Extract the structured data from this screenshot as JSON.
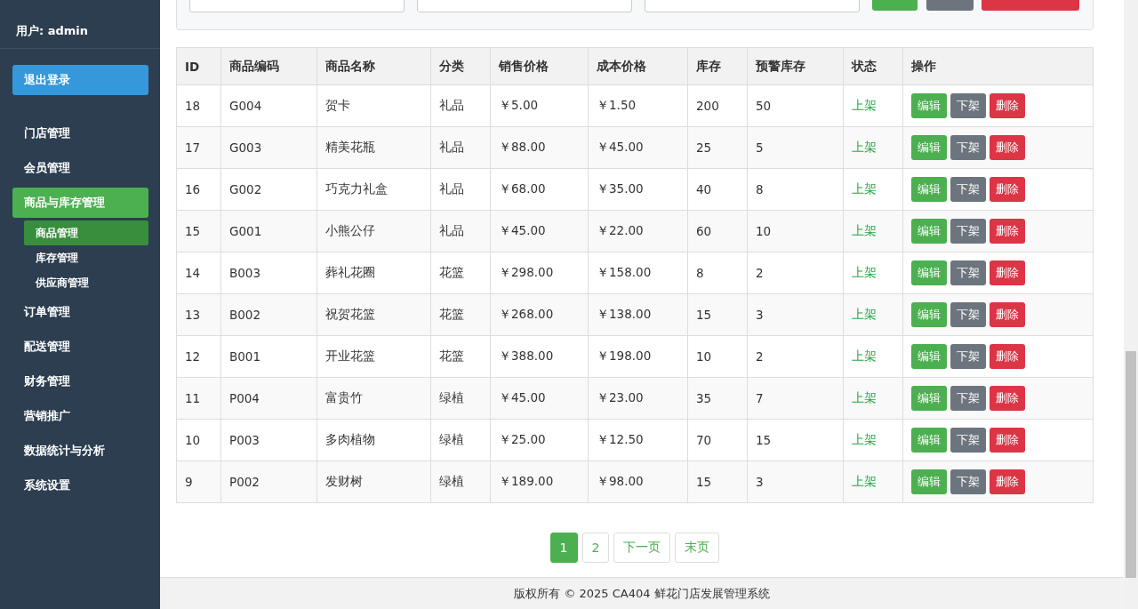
{
  "sidebar": {
    "user": "用户: admin",
    "logout": "退出登录",
    "items": [
      {
        "label": "门店管理",
        "selected": false
      },
      {
        "label": "会员管理",
        "selected": false
      },
      {
        "label": "商品与库存管理",
        "selected": true,
        "children": [
          {
            "label": "商品管理",
            "selected": true
          },
          {
            "label": "库存管理",
            "selected": false
          },
          {
            "label": "供应商管理",
            "selected": false
          }
        ]
      },
      {
        "label": "订单管理",
        "selected": false
      },
      {
        "label": "配送管理",
        "selected": false
      },
      {
        "label": "财务管理",
        "selected": false
      },
      {
        "label": "营销推广",
        "selected": false
      },
      {
        "label": "数据统计与分析",
        "selected": false
      },
      {
        "label": "系统设置",
        "selected": false
      }
    ]
  },
  "table": {
    "columns": [
      "ID",
      "商品编码",
      "商品名称",
      "分类",
      "销售价格",
      "成本价格",
      "库存",
      "预警库存",
      "状态",
      "操作"
    ],
    "rows": [
      {
        "cells": [
          "18",
          "G004",
          "贺卡",
          "礼品",
          "￥5.00",
          "￥1.50",
          "200",
          "50"
        ],
        "status": "上架",
        "actions": [
          {
            "label": "编辑",
            "kind": "edit"
          },
          {
            "label": "下架",
            "kind": "toggle"
          },
          {
            "label": "删除",
            "kind": "delete"
          }
        ]
      },
      {
        "cells": [
          "17",
          "G003",
          "精美花瓶",
          "礼品",
          "￥88.00",
          "￥45.00",
          "25",
          "5"
        ],
        "status": "上架",
        "actions": [
          {
            "label": "编辑",
            "kind": "edit"
          },
          {
            "label": "下架",
            "kind": "toggle"
          },
          {
            "label": "删除",
            "kind": "delete"
          }
        ]
      },
      {
        "cells": [
          "16",
          "G002",
          "巧克力礼盒",
          "礼品",
          "￥68.00",
          "￥35.00",
          "40",
          "8"
        ],
        "status": "上架",
        "actions": [
          {
            "label": "编辑",
            "kind": "edit"
          },
          {
            "label": "下架",
            "kind": "toggle"
          },
          {
            "label": "删除",
            "kind": "delete"
          }
        ]
      },
      {
        "cells": [
          "15",
          "G001",
          "小熊公仔",
          "礼品",
          "￥45.00",
          "￥22.00",
          "60",
          "10"
        ],
        "status": "上架",
        "actions": [
          {
            "label": "编辑",
            "kind": "edit"
          },
          {
            "label": "下架",
            "kind": "toggle"
          },
          {
            "label": "删除",
            "kind": "delete"
          }
        ]
      },
      {
        "cells": [
          "14",
          "B003",
          "葬礼花圈",
          "花篮",
          "￥298.00",
          "￥158.00",
          "8",
          "2"
        ],
        "status": "上架",
        "actions": [
          {
            "label": "编辑",
            "kind": "edit"
          },
          {
            "label": "下架",
            "kind": "toggle"
          },
          {
            "label": "删除",
            "kind": "delete"
          }
        ]
      },
      {
        "cells": [
          "13",
          "B002",
          "祝贺花篮",
          "花篮",
          "￥268.00",
          "￥138.00",
          "15",
          "3"
        ],
        "status": "上架",
        "actions": [
          {
            "label": "编辑",
            "kind": "edit"
          },
          {
            "label": "下架",
            "kind": "toggle"
          },
          {
            "label": "删除",
            "kind": "delete"
          }
        ]
      },
      {
        "cells": [
          "12",
          "B001",
          "开业花篮",
          "花篮",
          "￥388.00",
          "￥198.00",
          "10",
          "2"
        ],
        "status": "上架",
        "actions": [
          {
            "label": "编辑",
            "kind": "edit"
          },
          {
            "label": "下架",
            "kind": "toggle"
          },
          {
            "label": "删除",
            "kind": "delete"
          }
        ]
      },
      {
        "cells": [
          "11",
          "P004",
          "富贵竹",
          "绿植",
          "￥45.00",
          "￥23.00",
          "35",
          "7"
        ],
        "status": "上架",
        "actions": [
          {
            "label": "编辑",
            "kind": "edit"
          },
          {
            "label": "下架",
            "kind": "toggle"
          },
          {
            "label": "删除",
            "kind": "delete"
          }
        ]
      },
      {
        "cells": [
          "10",
          "P003",
          "多肉植物",
          "绿植",
          "￥25.00",
          "￥12.50",
          "70",
          "15"
        ],
        "status": "上架",
        "actions": [
          {
            "label": "编辑",
            "kind": "edit"
          },
          {
            "label": "下架",
            "kind": "toggle"
          },
          {
            "label": "删除",
            "kind": "delete"
          }
        ]
      },
      {
        "cells": [
          "9",
          "P002",
          "发财树",
          "绿植",
          "￥189.00",
          "￥98.00",
          "15",
          "3"
        ],
        "status": "上架",
        "actions": [
          {
            "label": "编辑",
            "kind": "edit"
          },
          {
            "label": "下架",
            "kind": "toggle"
          },
          {
            "label": "删除",
            "kind": "delete"
          }
        ]
      }
    ]
  },
  "pagination": {
    "pages": [
      {
        "label": "1",
        "selected": true
      },
      {
        "label": "2",
        "selected": false
      }
    ],
    "links": [
      "下一页",
      "末页"
    ]
  },
  "footer": "版权所有 © 2025 CA404 鲜花门店发展管理系统"
}
